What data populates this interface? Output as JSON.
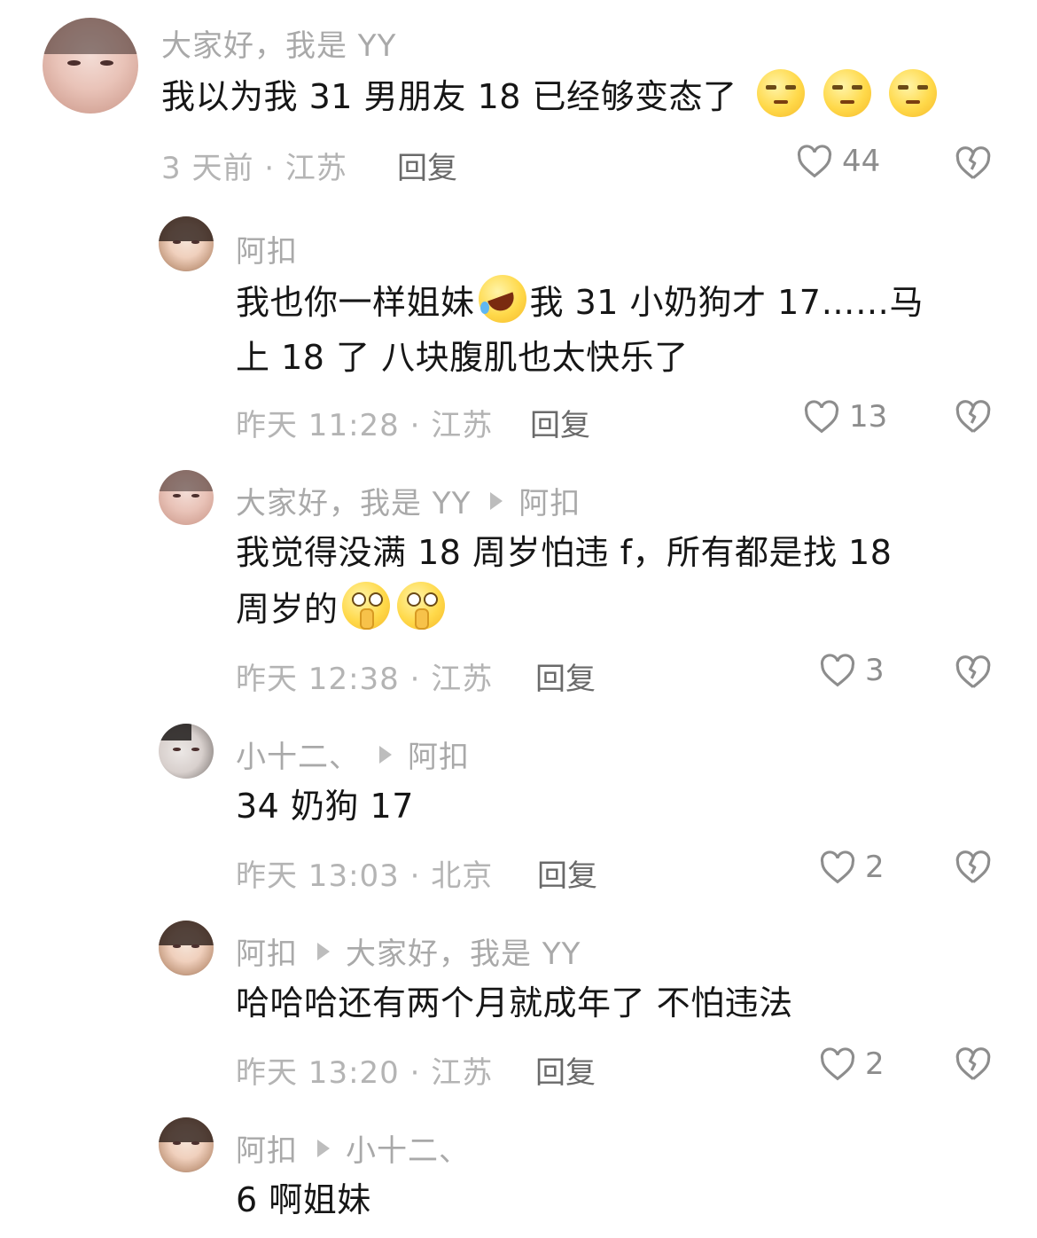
{
  "reply_label": "回复",
  "colors": {
    "muted": "#a9a9a9",
    "text": "#161616",
    "reply": "#6a6a6a",
    "icon": "#8d8d8d"
  },
  "comments": [
    {
      "name": "大家好，我是 YY",
      "text": "我以为我 31 男朋友 18 已经够变态了",
      "emojis": [
        "unamused-face",
        "unamused-face",
        "unamused-face"
      ],
      "meta": "3 天前 · 江苏",
      "likes": "44"
    },
    {
      "name": "阿扣",
      "line1": "我也你一样姐妹",
      "line1_after_emoji": "我 31 小奶狗才 17……马",
      "line2": "上 18 了  八块腹肌也太快乐了",
      "emojis": [
        "rolling-on-floor-laughing"
      ],
      "meta": "昨天 11:28 · 江苏",
      "likes": "13"
    },
    {
      "name": "大家好，我是 YY",
      "reply_to": "阿扣",
      "line1": "我觉得没满 18 周岁怕违 f，所有都是找 18",
      "line2": "周岁的",
      "emojis": [
        "shushing-face",
        "shushing-face"
      ],
      "meta": "昨天 12:38 · 江苏",
      "likes": "3"
    },
    {
      "name": "小十二、",
      "reply_to": "阿扣",
      "text": "34 奶狗 17",
      "meta": "昨天 13:03 · 北京",
      "likes": "2"
    },
    {
      "name": "阿扣",
      "reply_to": "大家好，我是 YY",
      "text": "哈哈哈还有两个月就成年了  不怕违法",
      "meta": "昨天 13:20 · 江苏",
      "likes": "2"
    },
    {
      "name": "阿扣",
      "reply_to": "小十二、",
      "text": "6 啊姐妹"
    }
  ]
}
